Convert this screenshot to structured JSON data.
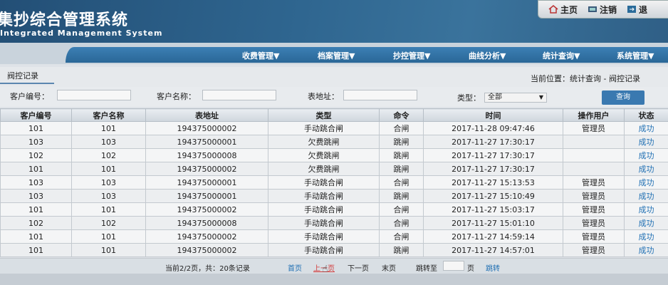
{
  "header": {
    "title_cn": "集抄综合管理系统",
    "title_en": "Integrated Management System",
    "links": [
      {
        "label": "主页",
        "icon": "home-icon"
      },
      {
        "label": "注销",
        "icon": "logout-icon"
      },
      {
        "label": "退",
        "icon": "exit-icon"
      }
    ]
  },
  "nav": [
    "收费管理▼",
    "档案管理▼",
    "抄控管理▼",
    "曲线分析▼",
    "统计查询▼",
    "系统管理▼"
  ],
  "tab": "阀控记录",
  "breadcrumb": "当前位置：统计查询 - 阀控记录",
  "search": {
    "customer_no_label": "客户编号：",
    "customer_name_label": "客户名称：",
    "meter_addr_label": "表地址：",
    "type_label": "类型：",
    "type_value": "全部",
    "query_button": "查询"
  },
  "table": {
    "headers": [
      "客户编号",
      "客户名称",
      "表地址",
      "类型",
      "命令",
      "时间",
      "操作用户",
      "状态"
    ],
    "rows": [
      [
        "101",
        "101",
        "194375000002",
        "手动跳合闸",
        "合闸",
        "2017-11-28 09:47:46",
        "管理员",
        "成功"
      ],
      [
        "103",
        "103",
        "194375000001",
        "欠费跳闸",
        "跳闸",
        "2017-11-27 17:30:17",
        "",
        "成功"
      ],
      [
        "102",
        "102",
        "194375000008",
        "欠费跳闸",
        "跳闸",
        "2017-11-27 17:30:17",
        "",
        "成功"
      ],
      [
        "101",
        "101",
        "194375000002",
        "欠费跳闸",
        "跳闸",
        "2017-11-27 17:30:17",
        "",
        "成功"
      ],
      [
        "103",
        "103",
        "194375000001",
        "手动跳合闸",
        "合闸",
        "2017-11-27 15:13:53",
        "管理员",
        "成功"
      ],
      [
        "103",
        "103",
        "194375000001",
        "手动跳合闸",
        "跳闸",
        "2017-11-27 15:10:49",
        "管理员",
        "成功"
      ],
      [
        "101",
        "101",
        "194375000002",
        "手动跳合闸",
        "合闸",
        "2017-11-27 15:03:17",
        "管理员",
        "成功"
      ],
      [
        "102",
        "102",
        "194375000008",
        "手动跳合闸",
        "合闸",
        "2017-11-27 15:01:10",
        "管理员",
        "成功"
      ],
      [
        "101",
        "101",
        "194375000002",
        "手动跳合闸",
        "合闸",
        "2017-11-27 14:59:14",
        "管理员",
        "成功"
      ],
      [
        "101",
        "101",
        "194375000002",
        "手动跳合闸",
        "跳闸",
        "2017-11-27 14:57:01",
        "管理员",
        "成功"
      ]
    ]
  },
  "pager": {
    "info": "当前2/2页，共：20条记录",
    "first": "首页",
    "prev": "上一页",
    "next": "下一页",
    "last": "末页",
    "jump_label": "跳转至",
    "page_unit": "页",
    "jump_button": "跳转"
  }
}
